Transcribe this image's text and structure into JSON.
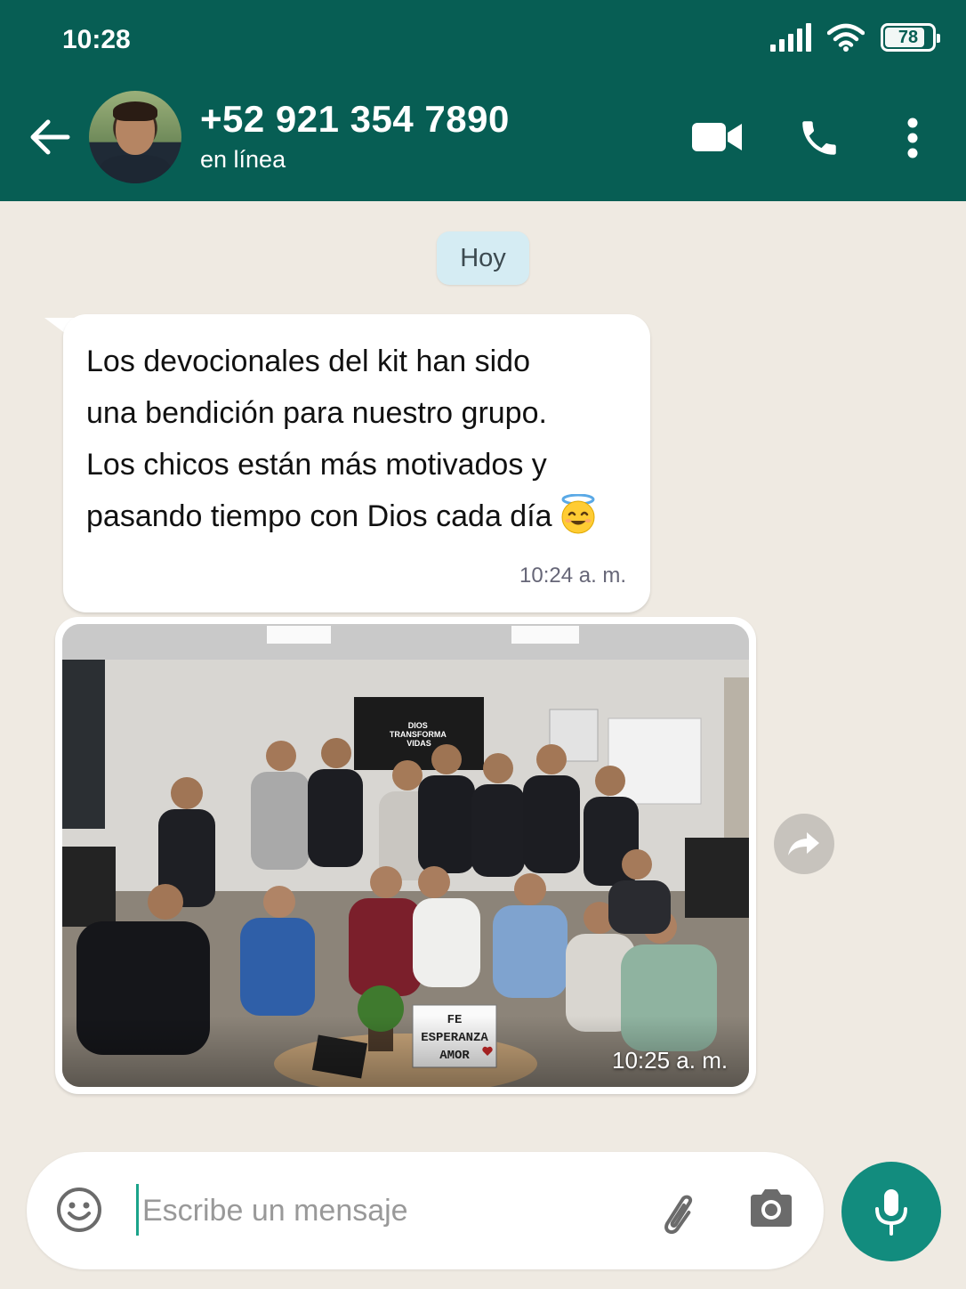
{
  "status_bar": {
    "time": "10:28",
    "battery": "78",
    "battery_level_percent": 78,
    "icons": [
      "signal-icon",
      "wifi-icon",
      "battery-icon"
    ]
  },
  "header": {
    "back_icon": "arrow-left-icon",
    "contact_name": "+52 921 354 7890",
    "contact_status": "en línea",
    "actions": [
      "video-call-icon",
      "phone-call-icon",
      "more-vert-icon"
    ]
  },
  "chat": {
    "date_label": "Hoy",
    "messages": [
      {
        "type": "text",
        "text": "Los devocionales del kit han sido una bendición para nuestro grupo. Los chicos están más motivados y pasando tiempo con Dios cada día",
        "lines": [
          "Los devocionales del kit han sido",
          "una bendición para nuestro grupo.",
          "Los chicos están más motivados y",
          "pasando tiempo con Dios cada día"
        ],
        "emoji": "smiling-face-with-halo",
        "time": "10:24 a. m."
      },
      {
        "type": "image",
        "time": "10:25 a. m.",
        "image_texts": {
          "tv_screen": "DIOS TRANSFORMA VIDAS",
          "lightbox_lines": [
            "FE",
            "ESPERANZA",
            "AMOR"
          ]
        }
      }
    ]
  },
  "composer": {
    "placeholder": "Escribe un mensaje",
    "value": "",
    "icons": [
      "emoji-icon",
      "attach-icon",
      "camera-icon",
      "mic-icon"
    ]
  },
  "colors": {
    "header": "#075e54",
    "mic_button": "#128c7e",
    "chat_background": "#efeae2",
    "date_pill": "#d5ecf3"
  }
}
